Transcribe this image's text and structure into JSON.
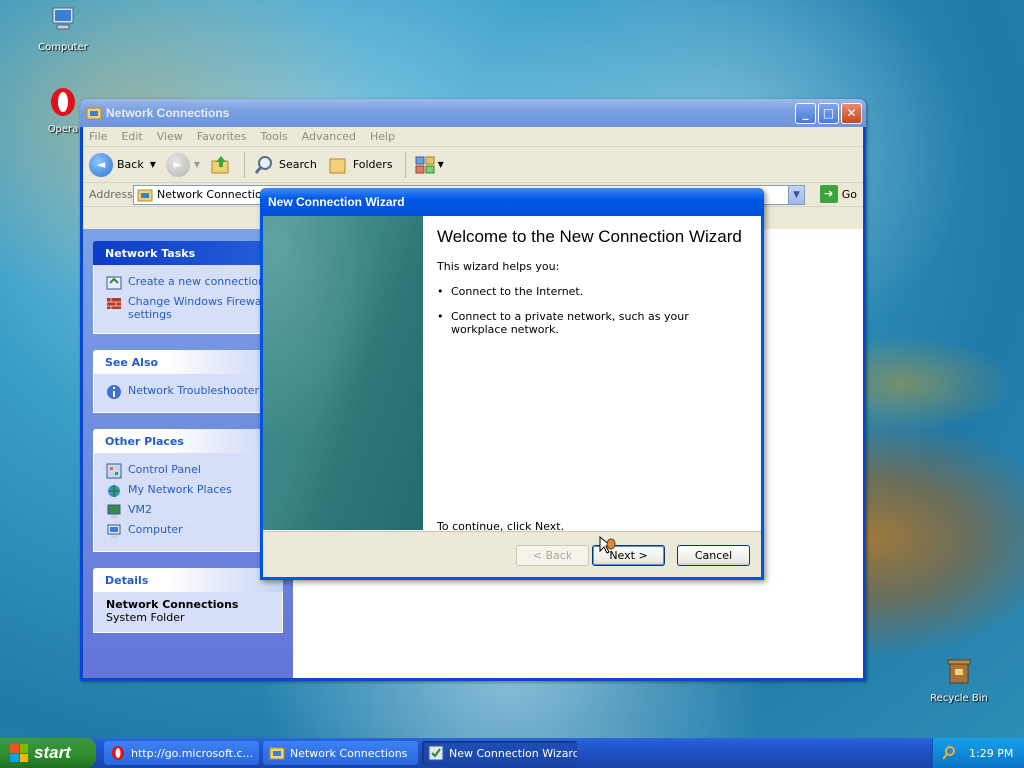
{
  "desktop": {
    "icons": [
      {
        "label": "Computer",
        "icon": "computer-icon"
      },
      {
        "label": "Opera",
        "icon": "opera-icon"
      },
      {
        "label": "Recycle Bin",
        "icon": "recycle-bin-icon"
      }
    ]
  },
  "explorer": {
    "title": "Network Connections",
    "menu": [
      "File",
      "Edit",
      "View",
      "Favorites",
      "Tools",
      "Advanced",
      "Help"
    ],
    "toolbar": {
      "back": "Back",
      "search": "Search",
      "folders": "Folders"
    },
    "address_label": "Address",
    "address_value": "Network Connections",
    "go_label": "Go",
    "taskpane": {
      "network_tasks": {
        "title": "Network Tasks",
        "items": [
          "Create a new connection",
          "Change Windows Firewall settings"
        ]
      },
      "see_also": {
        "title": "See Also",
        "items": [
          "Network Troubleshooter"
        ]
      },
      "other_places": {
        "title": "Other Places",
        "items": [
          "Control Panel",
          "My Network Places",
          "VM2",
          "Computer"
        ]
      },
      "details": {
        "title": "Details",
        "name": "Network Connections",
        "type": "System Folder"
      }
    }
  },
  "wizard": {
    "title": "New Connection Wizard",
    "heading": "Welcome to the New Connection Wizard",
    "intro": "This wizard helps you:",
    "bullets": [
      "Connect to the Internet.",
      "Connect to a private network, such as your workplace network."
    ],
    "continue_text": "To continue, click Next.",
    "buttons": {
      "back": "< Back",
      "next": "Next >",
      "cancel": "Cancel"
    }
  },
  "taskbar": {
    "start": "start",
    "tasks": [
      {
        "label": "http://go.microsoft.c...",
        "icon": "opera-icon"
      },
      {
        "label": "Network Connections",
        "icon": "network-folder-icon"
      },
      {
        "label": "New Connection Wizard",
        "icon": "wizard-icon",
        "active": true
      }
    ],
    "clock": "1:29 PM"
  }
}
